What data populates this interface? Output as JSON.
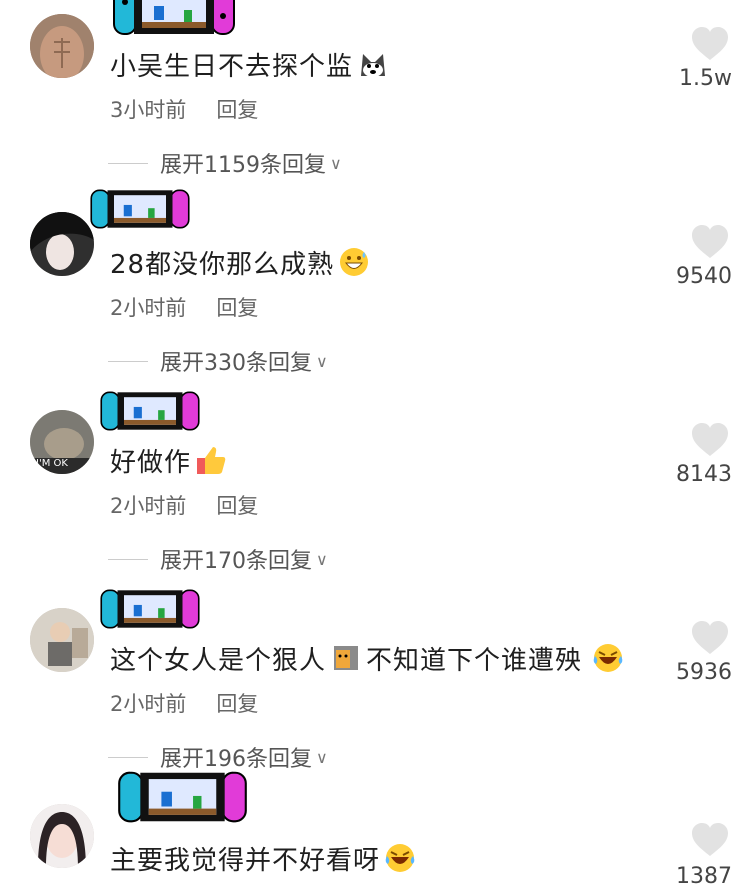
{
  "reply_label": "回复",
  "comments": [
    {
      "text": "小吴生日不去探个监",
      "time": "3小时前",
      "expand": "展开1159条回复",
      "likes": "1.5w",
      "emoji": "husky-emoji"
    },
    {
      "text": "28都没你那么成熟",
      "time": "2小时前",
      "expand": "展开330条回复",
      "likes": "9540",
      "emoji": "grinning-sweat-emoji"
    },
    {
      "text": "好做作",
      "time": "2小时前",
      "expand": "展开170条回复",
      "likes": "8143",
      "emoji": "thumbs-up-emoji",
      "avatar_text": "I'M OK"
    },
    {
      "text_a": "这个女人是个狠人",
      "text_b": "不知道下个谁遭殃",
      "time": "2小时前",
      "expand": "展开196条回复",
      "likes": "5936",
      "emoji": "laughing-tears-emoji"
    },
    {
      "text": "主要我觉得并不好看呀",
      "likes": "1387",
      "emoji": "laughing-tears-emoji"
    }
  ],
  "colors": {
    "text": "#1f1f1f",
    "meta": "#666666",
    "switch_left": "#22b8d8",
    "switch_right": "#e13bd8"
  }
}
